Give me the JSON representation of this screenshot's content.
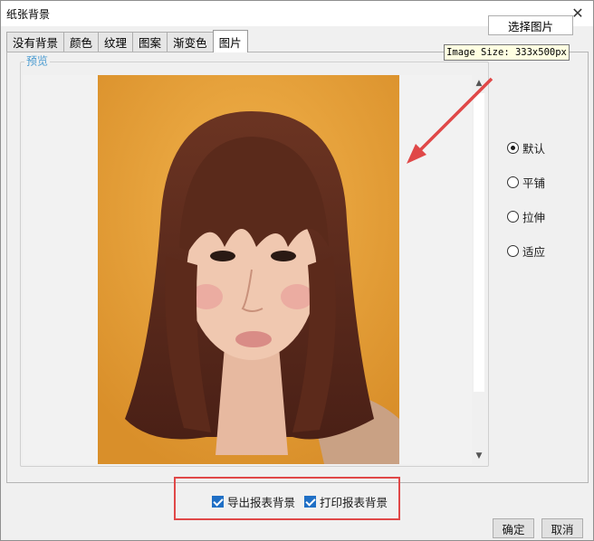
{
  "window": {
    "title": "纸张背景",
    "close_glyph": "✕"
  },
  "tabs": [
    {
      "label": "没有背景"
    },
    {
      "label": "颜色"
    },
    {
      "label": "纹理"
    },
    {
      "label": "图案"
    },
    {
      "label": "渐变色"
    },
    {
      "label": "图片",
      "active": true
    }
  ],
  "preview": {
    "legend": "预览"
  },
  "image_panel": {
    "choose_button": "选择图片",
    "tooltip": "Image Size: 333x500px"
  },
  "layout_options": [
    {
      "label": "默认",
      "checked": true
    },
    {
      "label": "平铺",
      "checked": false
    },
    {
      "label": "拉伸",
      "checked": false
    },
    {
      "label": "适应",
      "checked": false
    }
  ],
  "export_options": [
    {
      "label": "导出报表背景",
      "checked": true
    },
    {
      "label": "打印报表背景",
      "checked": true
    }
  ],
  "buttons": {
    "ok": "确定",
    "cancel": "取消"
  },
  "colors": {
    "accent": "#1f6fc5",
    "highlight_border": "#e04848",
    "legend": "#4a9bd1",
    "photo_bg": "#e9a23c"
  },
  "icons": {
    "close": "close-icon",
    "scroll_up": "chevron-up-icon",
    "scroll_down": "chevron-down-icon"
  }
}
